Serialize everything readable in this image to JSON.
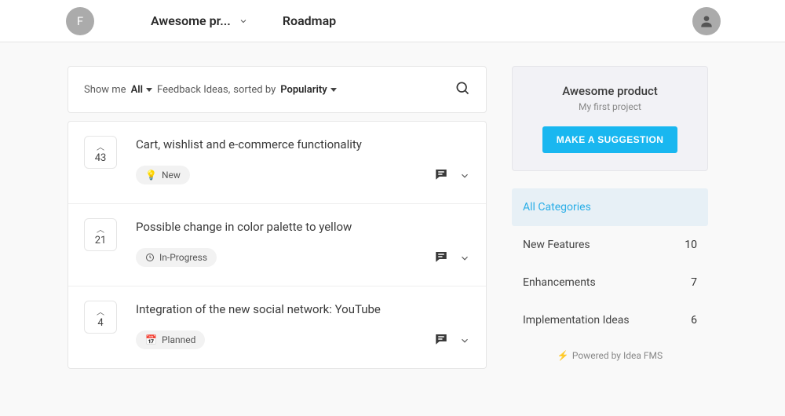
{
  "header": {
    "workspace_initial": "F",
    "project_name": "Awesome pr...",
    "roadmap_label": "Roadmap"
  },
  "filter": {
    "show_me": "Show me",
    "all": "All",
    "feedback_ideas": "Feedback Ideas,",
    "sorted_by": "sorted by",
    "popularity": "Popularity"
  },
  "items": [
    {
      "votes": "43",
      "title": "Cart, wishlist and e-commerce functionality",
      "status": "New",
      "status_icon": "bulb"
    },
    {
      "votes": "21",
      "title": "Possible change in color palette to yellow",
      "status": "In-Progress",
      "status_icon": "clock"
    },
    {
      "votes": "4",
      "title": "Integration of the new social network: YouTube",
      "status": "Planned",
      "status_icon": "calendar"
    }
  ],
  "panel": {
    "title": "Awesome product",
    "subtitle": "My first project",
    "button": "MAKE A SUGGESTION"
  },
  "categories": [
    {
      "label": "All Categories",
      "count": "",
      "active": true
    },
    {
      "label": "New Features",
      "count": "10",
      "active": false
    },
    {
      "label": "Enhancements",
      "count": "7",
      "active": false
    },
    {
      "label": "Implementation Ideas",
      "count": "6",
      "active": false
    }
  ],
  "powered": "Powered by Idea FMS"
}
